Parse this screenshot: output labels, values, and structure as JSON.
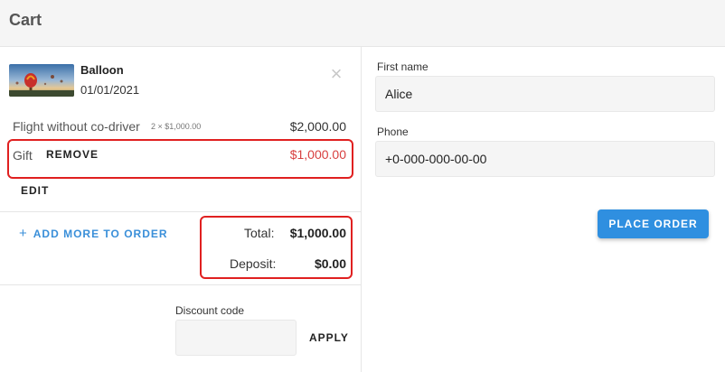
{
  "header": {
    "title": "Cart"
  },
  "cart": {
    "item": {
      "name": "Balloon",
      "date": "01/01/2021",
      "thumbnail_icon": "hot-air-balloon-image",
      "close_icon": "close-icon"
    },
    "line": {
      "label": "Flight without co-driver",
      "quantity": "2 × $1,000.00",
      "price": "$2,000.00"
    },
    "gift": {
      "label": "Gift",
      "remove_label": "REMOVE",
      "amount": "$1,000.00"
    },
    "edit_label": "EDIT",
    "add_more_label": "ADD MORE TO ORDER",
    "add_more_icon": "plus-icon",
    "totals": {
      "total_label": "Total:",
      "total_value": "$1,000.00",
      "deposit_label": "Deposit:",
      "deposit_value": "$0.00"
    },
    "discount": {
      "label": "Discount code",
      "value": "",
      "apply_label": "APPLY"
    }
  },
  "form": {
    "first_name": {
      "label": "First name",
      "value": "Alice"
    },
    "phone": {
      "label": "Phone",
      "value": "+0-000-000-00-00"
    },
    "place_order_label": "PLACE ORDER"
  },
  "colors": {
    "accent": "#2f8fe0",
    "highlight_border": "#e02020",
    "gift_amount": "#d84040",
    "link": "#3a8fd9"
  }
}
